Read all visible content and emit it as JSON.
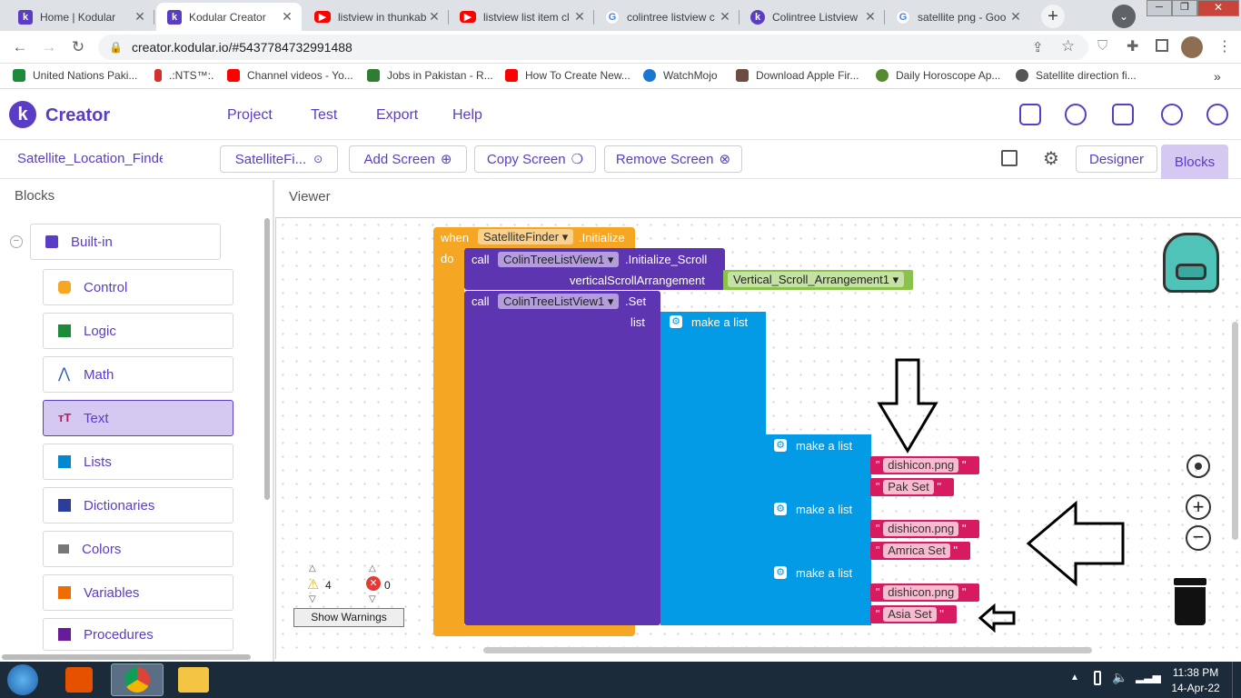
{
  "browser": {
    "tabs": [
      {
        "title": "Home | Kodular",
        "icon": "kodular-icon"
      },
      {
        "title": "Kodular Creator",
        "icon": "kodular-icon"
      },
      {
        "title": "listview in thunkable",
        "icon": "youtube-icon"
      },
      {
        "title": "listview list item cl",
        "icon": "youtube-icon"
      },
      {
        "title": "colintree listview c",
        "icon": "google-icon"
      },
      {
        "title": "Colintree Listview",
        "icon": "kodular-icon"
      },
      {
        "title": "satellite png - Goo",
        "icon": "google-icon"
      }
    ],
    "url": "creator.kodular.io/#5437784732991488",
    "bookmarks": [
      "United Nations Paki...",
      ".:NTS™:.",
      "Channel videos - Yo...",
      "Jobs in Pakistan - R...",
      "How To Create New...",
      "WatchMojo",
      "Download Apple Fir...",
      "Daily Horoscope Ap...",
      "Satellite direction fi..."
    ]
  },
  "app": {
    "name": "Creator",
    "logo_letter": "k",
    "menu": [
      "Project",
      "Test",
      "Export",
      "Help"
    ],
    "project_name": "Satellite_Location_Finde",
    "screen_select": "SatelliteFi...",
    "add_screen": "Add Screen",
    "copy_screen": "Copy Screen",
    "remove_screen": "Remove Screen",
    "designer": "Designer",
    "blocks_tab": "Blocks"
  },
  "blocks_panel": {
    "title": "Blocks",
    "builtin": "Built-in",
    "categories": [
      {
        "label": "Control",
        "color": "#f5a623"
      },
      {
        "label": "Logic",
        "color": "#1b8a3a"
      },
      {
        "label": "Math",
        "color": "#2b5fa8"
      },
      {
        "label": "Text",
        "color": "#c2185b"
      },
      {
        "label": "Lists",
        "color": "#0288d1"
      },
      {
        "label": "Dictionaries",
        "color": "#2c3e9a"
      },
      {
        "label": "Colors",
        "color": "#777777"
      },
      {
        "label": "Variables",
        "color": "#ef6c00"
      },
      {
        "label": "Procedures",
        "color": "#6a1b9a"
      }
    ],
    "selected": "Text"
  },
  "viewer": {
    "title": "Viewer",
    "event": {
      "when": "when",
      "component": "SatelliteFinder",
      "event": ".Initialize",
      "do": "do"
    },
    "call1": {
      "call": "call",
      "component": "ColinTreeListView1",
      "method": ".Initialize_Scroll",
      "param": "verticalScrollArrangement",
      "arg": "Vertical_Scroll_Arrangement1"
    },
    "call2": {
      "call": "call",
      "component": "ColinTreeListView1",
      "method": ".Set",
      "param": "list"
    },
    "make_list": "make a list",
    "sublists": [
      {
        "label": "make a list",
        "icon": "dishicon.png",
        "name": "Pak Set"
      },
      {
        "label": "make a list",
        "icon": "dishicon.png",
        "name": "Amrica Set"
      },
      {
        "label": "make a list",
        "icon": "dishicon.png",
        "name": "Asia Set"
      }
    ],
    "warnings_count": "4",
    "errors_count": "0",
    "show_warnings": "Show Warnings"
  },
  "taskbar": {
    "time": "11:38 PM",
    "date": "14-Apr-22"
  }
}
